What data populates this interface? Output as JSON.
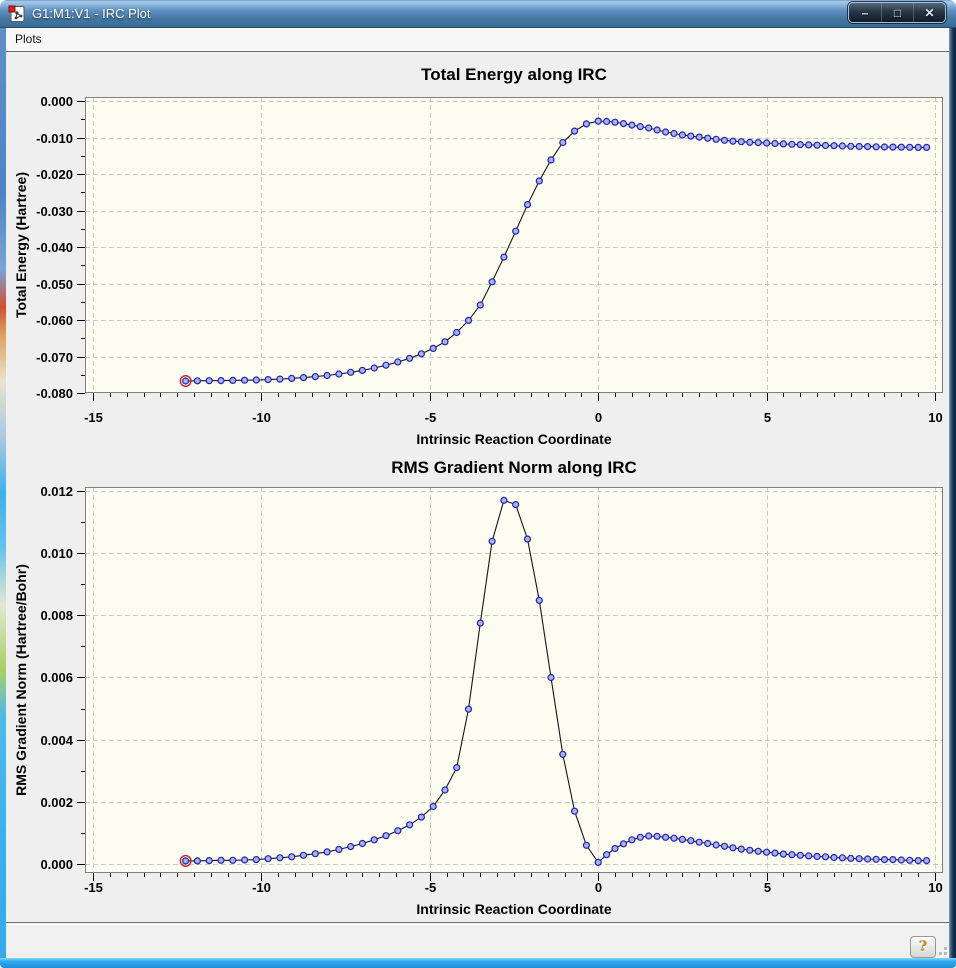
{
  "window": {
    "title": "G1:M1:V1 - IRC Plot",
    "controls": {
      "minimize": "–",
      "maximize": "□",
      "close": "✕"
    }
  },
  "menu": {
    "items": [
      {
        "label": "Plots"
      }
    ]
  },
  "status_bar": {
    "help_label": "?"
  },
  "colors": {
    "titlebar_blue": "#4a80b8",
    "window_border_bottom": "#2aa3ec",
    "plot_background": "#fcfcf0",
    "grid": "#c9c9c9",
    "frame": "#7f7f7f",
    "line": "#151515",
    "marker_fill": "#a8b4e6",
    "marker_stroke": "#2121bb",
    "first_point_ring": "#cc2020"
  },
  "chart_data": [
    {
      "type": "line",
      "title": "Total Energy along IRC",
      "xlabel": "Intrinsic Reaction Coordinate",
      "ylabel": "Total Energy (Hartree)",
      "legend": "none",
      "grid": true,
      "highlight_first_point": true,
      "xlim": [
        -15.2376,
        10.2376
      ],
      "ylim": [
        -0.08,
        0.0011
      ],
      "xticks": {
        "values": [
          -15,
          -10,
          -5,
          0,
          5,
          10
        ],
        "labels": [
          "-15",
          "-10",
          "-5",
          "0",
          "5",
          "10"
        ],
        "minor_step": 0.5
      },
      "yticks": {
        "values": [
          0,
          -0.01,
          -0.02,
          -0.03,
          -0.04,
          -0.05,
          -0.06,
          -0.07,
          -0.08
        ],
        "labels": [
          "0.000",
          "-0.010",
          "-0.020",
          "-0.030",
          "-0.040",
          "-0.050",
          "-0.060",
          "-0.070",
          "-0.080"
        ],
        "minor_step": 0.005
      },
      "x": [
        -12.25,
        -11.9,
        -11.55,
        -11.2,
        -10.85,
        -10.5,
        -10.15,
        -9.8,
        -9.45,
        -9.1,
        -8.75,
        -8.4,
        -8.05,
        -7.7,
        -7.35,
        -7.0,
        -6.65,
        -6.3,
        -5.95,
        -5.6,
        -5.25,
        -4.9,
        -4.55,
        -4.2,
        -3.85,
        -3.5,
        -3.15,
        -2.8,
        -2.45,
        -2.1,
        -1.75,
        -1.4,
        -1.05,
        -0.7,
        -0.35,
        0.0,
        0.25,
        0.5,
        0.75,
        1.0,
        1.25,
        1.5,
        1.75,
        2.0,
        2.25,
        2.5,
        2.75,
        3.0,
        3.25,
        3.5,
        3.75,
        4.0,
        4.25,
        4.5,
        4.75,
        5.0,
        5.25,
        5.5,
        5.75,
        6.0,
        6.25,
        6.5,
        6.75,
        7.0,
        7.25,
        7.5,
        7.75,
        8.0,
        8.25,
        8.5,
        8.75,
        9.0,
        9.25,
        9.5,
        9.75
      ],
      "y": [
        -0.0767,
        -0.07667,
        -0.07664,
        -0.0766,
        -0.07656,
        -0.0765,
        -0.07643,
        -0.07632,
        -0.07618,
        -0.076,
        -0.07578,
        -0.07551,
        -0.0752,
        -0.07479,
        -0.07433,
        -0.0738,
        -0.07314,
        -0.07237,
        -0.07151,
        -0.07049,
        -0.06925,
        -0.06778,
        -0.06596,
        -0.06342,
        -0.0601,
        -0.0559,
        -0.04953,
        -0.04276,
        -0.03566,
        -0.02838,
        -0.0219,
        -0.01614,
        -0.01138,
        -0.00824,
        -0.00627,
        -0.0055,
        -0.0056,
        -0.0058,
        -0.0062,
        -0.0066,
        -0.007,
        -0.0074,
        -0.00795,
        -0.0085,
        -0.0089,
        -0.0093,
        -0.0096,
        -0.0099,
        -0.0102,
        -0.0105,
        -0.01075,
        -0.011,
        -0.01115,
        -0.0113,
        -0.0114,
        -0.0115,
        -0.01163,
        -0.01175,
        -0.01185,
        -0.01195,
        -0.01203,
        -0.0121,
        -0.01218,
        -0.01225,
        -0.01233,
        -0.0124,
        -0.01245,
        -0.0125,
        -0.01255,
        -0.0126,
        -0.01263,
        -0.01265,
        -0.01268,
        -0.0127,
        -0.01271
      ]
    },
    {
      "type": "line",
      "title": "RMS Gradient Norm along IRC",
      "xlabel": "Intrinsic Reaction Coordinate",
      "ylabel": "RMS Gradient Norm (Hartree/Bohr)",
      "legend": "none",
      "grid": true,
      "highlight_first_point": true,
      "xlim": [
        -15.2376,
        10.2376
      ],
      "ylim": [
        -0.0002895,
        0.012127
      ],
      "xticks": {
        "values": [
          -15,
          -10,
          -5,
          0,
          5,
          10
        ],
        "labels": [
          "-15",
          "-10",
          "-5",
          "0",
          "5",
          "10"
        ],
        "minor_step": 0.5
      },
      "yticks": {
        "values": [
          0,
          0.002,
          0.004,
          0.006,
          0.008,
          0.01,
          0.012
        ],
        "labels": [
          "0.000",
          "0.002",
          "0.004",
          "0.006",
          "0.008",
          "0.010",
          "0.012"
        ],
        "minor_step": 0.001
      },
      "x": [
        -12.25,
        -11.9,
        -11.55,
        -11.2,
        -10.85,
        -10.5,
        -10.15,
        -9.8,
        -9.45,
        -9.1,
        -8.75,
        -8.4,
        -8.05,
        -7.7,
        -7.35,
        -7.0,
        -6.65,
        -6.3,
        -5.95,
        -5.6,
        -5.25,
        -4.9,
        -4.55,
        -4.2,
        -3.85,
        -3.5,
        -3.15,
        -2.8,
        -2.45,
        -2.1,
        -1.75,
        -1.4,
        -1.05,
        -0.7,
        -0.35,
        0.0,
        0.25,
        0.5,
        0.75,
        1.0,
        1.25,
        1.5,
        1.75,
        2.0,
        2.25,
        2.5,
        2.75,
        3.0,
        3.25,
        3.5,
        3.75,
        4.0,
        4.25,
        4.5,
        4.75,
        5.0,
        5.25,
        5.5,
        5.75,
        6.0,
        6.25,
        6.5,
        6.75,
        7.0,
        7.25,
        7.5,
        7.75,
        8.0,
        8.25,
        8.5,
        8.75,
        9.0,
        9.25,
        9.5,
        9.75
      ],
      "y": [
        0.0001,
        0.0001,
        0.00011,
        0.00012,
        0.00012,
        0.00013,
        0.00014,
        0.00017,
        0.0002,
        0.00023,
        0.00028,
        0.00033,
        0.00039,
        0.00047,
        0.00056,
        0.00066,
        0.00078,
        0.00091,
        0.00107,
        0.00126,
        0.00151,
        0.00185,
        0.00238,
        0.0031,
        0.00498,
        0.00775,
        0.01038,
        0.0117,
        0.01156,
        0.01045,
        0.00848,
        0.006,
        0.00353,
        0.0017,
        0.0006,
        5e-05,
        0.0003,
        0.0005,
        0.00065,
        0.00078,
        0.00086,
        0.0009,
        0.00089,
        0.00086,
        0.00083,
        0.00079,
        0.00075,
        0.0007,
        0.00066,
        0.00061,
        0.00057,
        0.00052,
        0.00048,
        0.00044,
        0.00041,
        0.00038,
        0.00035,
        0.00032,
        0.0003,
        0.00028,
        0.00026,
        0.00024,
        0.00023,
        0.00021,
        0.0002,
        0.00018,
        0.00017,
        0.00016,
        0.00015,
        0.00014,
        0.00014,
        0.00013,
        0.00012,
        0.00011,
        0.00011
      ]
    }
  ]
}
